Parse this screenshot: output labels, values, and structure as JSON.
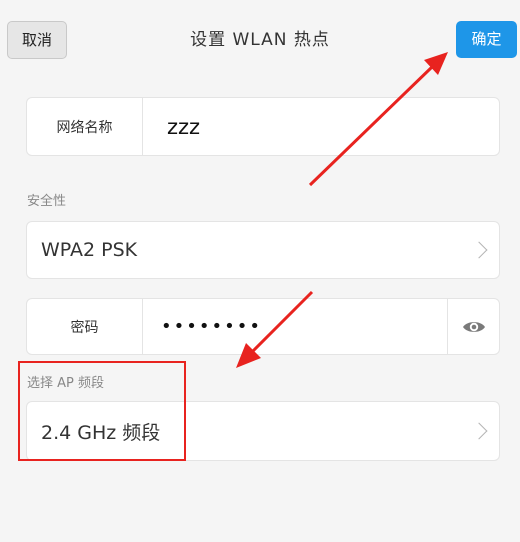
{
  "header": {
    "cancel_label": "取消",
    "title": "设置 WLAN 热点",
    "confirm_label": "确定"
  },
  "network_name": {
    "label": "网络名称",
    "value": "zzz"
  },
  "security": {
    "section_label": "安全性",
    "value": "WPA2 PSK"
  },
  "password": {
    "label": "密码",
    "value": "••••••••"
  },
  "ap_band": {
    "section_label": "选择 AP 频段",
    "value": "2.4 GHz 频段"
  },
  "colors": {
    "confirm_bg": "#1e96e8",
    "annotation_red": "#e8231f"
  },
  "icons": {
    "show_password": "eye-icon",
    "disclosure": "chevron-right-icon"
  }
}
